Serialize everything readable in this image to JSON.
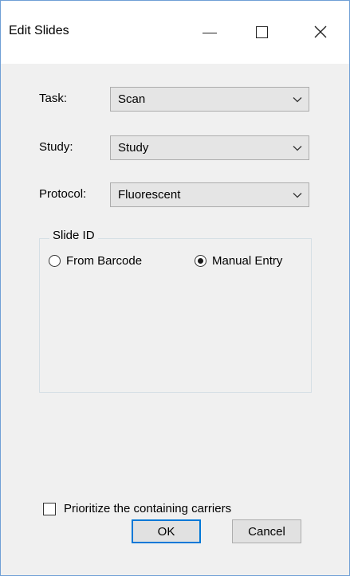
{
  "window": {
    "title": "Edit Slides",
    "controls": [
      "minimize-icon",
      "maximize-icon",
      "close-icon"
    ]
  },
  "form": {
    "task": {
      "label": "Task:",
      "value": "Scan"
    },
    "study": {
      "label": "Study:",
      "value": "Study"
    },
    "protocol": {
      "label": "Protocol:",
      "value": "Fluorescent"
    }
  },
  "slide_id": {
    "legend": "Slide ID",
    "options": [
      {
        "label": "From Barcode",
        "selected": false
      },
      {
        "label": "Manual Entry",
        "selected": true
      }
    ]
  },
  "prioritize": {
    "label": "Prioritize the containing carriers",
    "checked": false
  },
  "buttons": {
    "ok": "OK",
    "cancel": "Cancel"
  },
  "colors": {
    "window_border": "#6f9fd6",
    "ok_border": "#0078d7",
    "dialog_bg": "#f0f0f0"
  }
}
